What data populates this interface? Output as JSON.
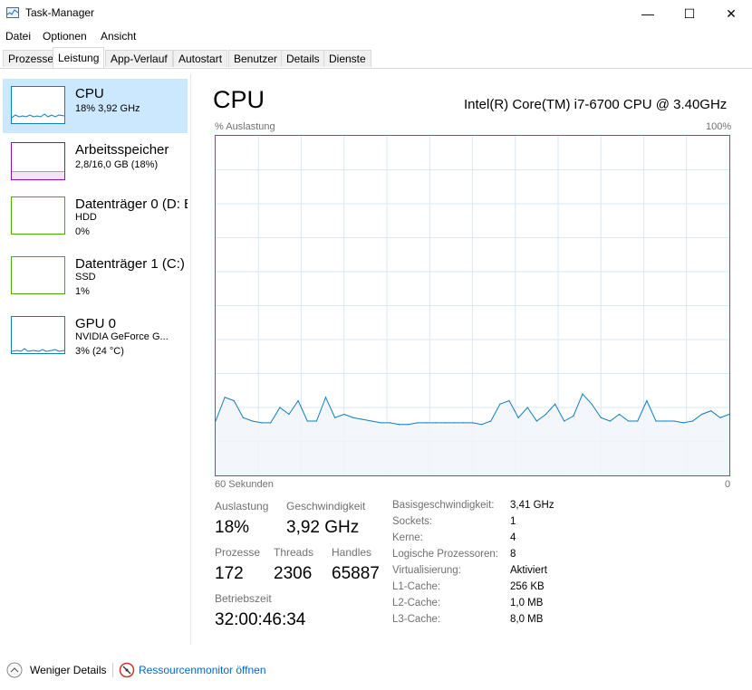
{
  "window": {
    "title": "Task-Manager",
    "minimize": "—",
    "maximize": "☐",
    "close": "✕"
  },
  "menu": [
    "Datei",
    "Optionen",
    "Ansicht"
  ],
  "tabs": [
    "Prozesse",
    "Leistung",
    "App-Verlauf",
    "Autostart",
    "Benutzer",
    "Details",
    "Dienste"
  ],
  "active_tab": "Leistung",
  "sidebar": [
    {
      "title": "CPU",
      "line1": "18%  3,92 GHz",
      "line2": "",
      "color": "#117dbb"
    },
    {
      "title": "Arbeitsspeicher",
      "line1": "2,8/16,0 GB (18%)",
      "line2": "",
      "color": "#8b12ae"
    },
    {
      "title": "Datenträger 0 (D: E",
      "line1": "HDD",
      "line2": "0%",
      "color": "#4da60c"
    },
    {
      "title": "Datenträger 1 (C:)",
      "line1": "SSD",
      "line2": "1%",
      "color": "#4da60c"
    },
    {
      "title": "GPU 0",
      "line1": "NVIDIA GeForce G...",
      "line2": "3%  (24 °C)",
      "color": "#117dbb"
    }
  ],
  "main": {
    "title": "CPU",
    "model": "Intel(R) Core(TM) i7-6700 CPU @ 3.40GHz",
    "y_label": "% Auslastung",
    "y_max_label": "100%",
    "x_label": "60 Sekunden",
    "x_min_label": "0"
  },
  "chart_data": {
    "type": "area",
    "title": "",
    "xlabel": "60 Sekunden",
    "ylabel": "% Auslastung",
    "ylim": [
      0,
      100
    ],
    "xlim": [
      60,
      0
    ],
    "grid": true,
    "color": "#117dbb",
    "series": [
      {
        "values": [
          16,
          23,
          22,
          17,
          16,
          15.5,
          15.5,
          20,
          18,
          22,
          16,
          16,
          23,
          17,
          18,
          17,
          16.5,
          16,
          15.5,
          15.5,
          15,
          15,
          15.5,
          15.5,
          15.5,
          15.5,
          15.5,
          15.5,
          15.5,
          15,
          16,
          21,
          22,
          17,
          20,
          16,
          18,
          21,
          16,
          17.5,
          24,
          21,
          17,
          16,
          18,
          16,
          16,
          22,
          16,
          16,
          16,
          15.5,
          16,
          18,
          19,
          17,
          18
        ]
      }
    ]
  },
  "stats": {
    "auslastung": {
      "label": "Auslastung",
      "value": "18%"
    },
    "geschwindigkeit": {
      "label": "Geschwindigkeit",
      "value": "3,92 GHz"
    },
    "prozesse": {
      "label": "Prozesse",
      "value": "172"
    },
    "threads": {
      "label": "Threads",
      "value": "2306"
    },
    "handles": {
      "label": "Handles",
      "value": "65887"
    },
    "betriebszeit": {
      "label": "Betriebszeit",
      "value": "32:00:46:34"
    }
  },
  "info": [
    {
      "label": "Basisgeschwindigkeit:",
      "value": "3,41 GHz"
    },
    {
      "label": "Sockets:",
      "value": "1"
    },
    {
      "label": "Kerne:",
      "value": "4"
    },
    {
      "label": "Logische Prozessoren:",
      "value": "8"
    },
    {
      "label": "Virtualisierung:",
      "value": "Aktiviert"
    },
    {
      "label": "L1-Cache:",
      "value": "256 KB"
    },
    {
      "label": "L2-Cache:",
      "value": "1,0 MB"
    },
    {
      "label": "L3-Cache:",
      "value": "8,0 MB"
    }
  ],
  "footer": {
    "less_details": "Weniger Details",
    "resource_monitor": "Ressourcenmonitor öffnen"
  }
}
